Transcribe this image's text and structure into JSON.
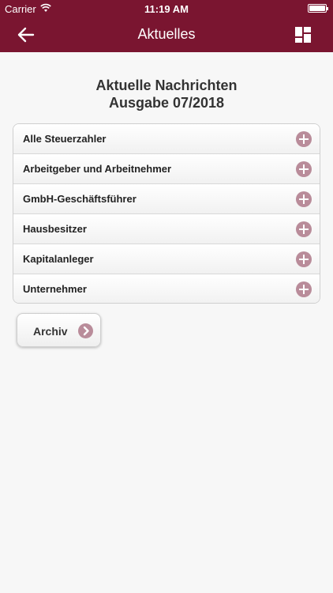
{
  "status_bar": {
    "carrier": "Carrier",
    "time": "11:19 AM",
    "battery_level": 1.0
  },
  "nav": {
    "title": "Aktuelles",
    "back_icon": "arrow-left-icon",
    "menu_icon": "grid-icon"
  },
  "headline": {
    "line1": "Aktuelle Nachrichten",
    "line2": "Ausgabe 07/2018"
  },
  "categories": [
    {
      "label": "Alle Steuerzahler",
      "icon": "plus-icon"
    },
    {
      "label": "Arbeitgeber und Arbeitnehmer",
      "icon": "plus-icon"
    },
    {
      "label": "GmbH-Geschäftsführer",
      "icon": "plus-icon"
    },
    {
      "label": "Hausbesitzer",
      "icon": "plus-icon"
    },
    {
      "label": "Kapitalanleger",
      "icon": "plus-icon"
    },
    {
      "label": "Unternehmer",
      "icon": "plus-icon"
    }
  ],
  "archive_button": {
    "label": "Archiv",
    "icon": "chevron-right-icon"
  },
  "colors": {
    "brand": "#7a1530",
    "icon_accent": "#b98c9a",
    "background": "#f7f7f7"
  }
}
